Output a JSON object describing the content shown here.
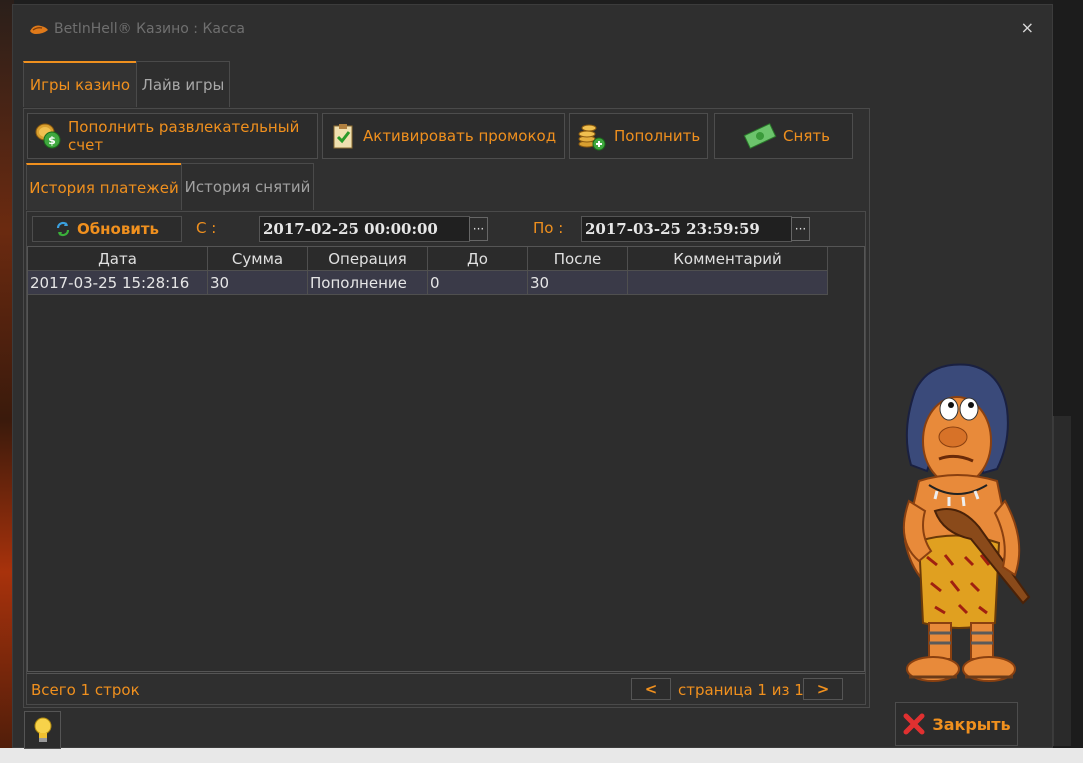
{
  "window": {
    "title": "BetInHell® Казино : Касса",
    "close_glyph": "×"
  },
  "main_tabs": [
    {
      "label": "Игры казино",
      "active": true
    },
    {
      "label": "Лайв игры",
      "active": false
    }
  ],
  "toolbar": {
    "deposit_entertainment": {
      "label": "Пополнить развлекательный счет",
      "icon": "coins-dollar-icon"
    },
    "activate_promo": {
      "label": "Активировать промокод",
      "icon": "clipboard-check-icon"
    },
    "deposit": {
      "label": "Пополнить",
      "icon": "coins-plus-icon"
    },
    "withdraw": {
      "label": "Снять",
      "icon": "banknote-icon"
    }
  },
  "sub_tabs": [
    {
      "label": "История платежей",
      "active": true
    },
    {
      "label": "История снятий",
      "active": false
    }
  ],
  "filter": {
    "refresh_label": "Обновить",
    "from_label": "С :",
    "from_value": "2017-02-25 00:00:00",
    "to_label": "По :",
    "to_value": "2017-03-25 23:59:59",
    "picker_glyph": "···"
  },
  "table": {
    "columns": [
      "Дата",
      "Сумма",
      "Операция",
      "До",
      "После",
      "Комментарий"
    ],
    "rows": [
      [
        "2017-03-25 15:28:16",
        "30",
        "Пополнение",
        "0",
        "30",
        ""
      ]
    ]
  },
  "status": {
    "total_label": "Всего 1 строк",
    "prev_glyph": "<",
    "next_glyph": ">",
    "page_label": "страница 1 из 1"
  },
  "footer": {
    "close_label": "Закрыть"
  },
  "colors": {
    "accent": "#f0901e",
    "background": "#2f2f2f",
    "row_highlight": "#3a3a48"
  }
}
